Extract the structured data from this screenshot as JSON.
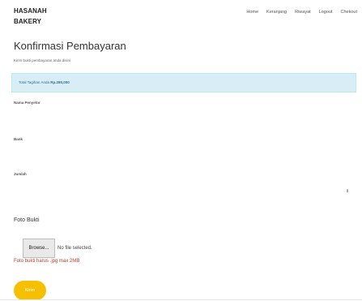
{
  "navbar": {
    "brand_line1": "HASANAH",
    "brand_line2": "BAKERY",
    "links": [
      "Home",
      "Keranjang",
      "Riwayat",
      "Logout",
      "Chekout"
    ]
  },
  "page": {
    "title": "Konfirmasi Pembayaran",
    "subtitle": "Kirim bukti pembayaran anda disini"
  },
  "alert": {
    "prefix": "Total Tagihan Anda",
    "amount": "Rp.280,000",
    "color_bg": "#d9edf7"
  },
  "form": {
    "nama_label": "Nama Penyetor",
    "bank_label": "Bank",
    "jumlah_label": "Jumlah",
    "foto_label": "Foto Bukti",
    "browse_label": "Browse...",
    "file_status": "No file selected.",
    "help_text": "Foto bukti harus .jpg max 2MB",
    "submit_label": "Kirim",
    "submit_color": "#f6c000"
  }
}
